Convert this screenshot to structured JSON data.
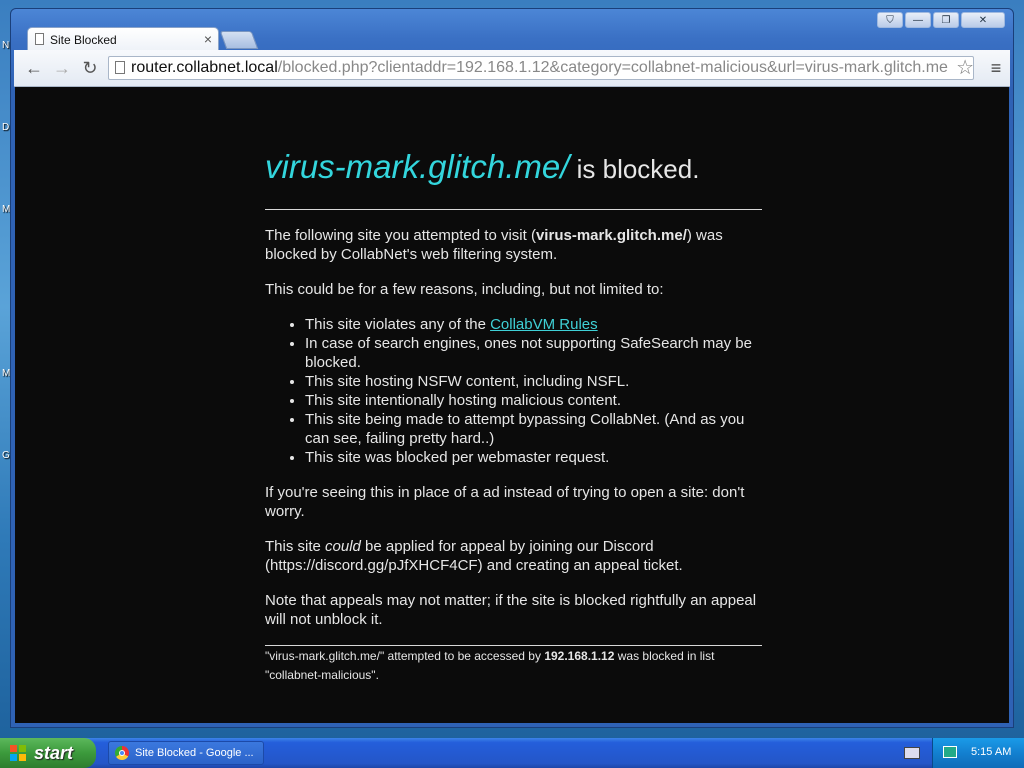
{
  "desktop": {
    "edge_letters": [
      "N",
      "D",
      "M",
      "M",
      "G"
    ]
  },
  "window": {
    "tab_title": "Site Blocked",
    "tab_close": "×",
    "controls": {
      "user": "⛉",
      "minimize": "—",
      "maximize": "❐",
      "close": "✕"
    }
  },
  "toolbar": {
    "back": "←",
    "forward": "→",
    "reload": "↻",
    "url_host": "router.collabnet.local",
    "url_path": "/blocked.php?clientaddr=192.168.1.12&category=collabnet-malicious&url=virus-mark.glitch.me",
    "star": "☆",
    "menu": "≡"
  },
  "page": {
    "heading_site": "virus-mark.glitch.me/",
    "heading_suffix": " is blocked.",
    "intro_pre": "The following site you attempted to visit (",
    "intro_site": "virus-mark.glitch.me/",
    "intro_post": ") was blocked by CollabNet's web filtering system.",
    "reasons_intro": "This could be for a few reasons, including, but not limited to:",
    "reason_1_pre": "This site violates any of the ",
    "reason_1_link": "CollabVM Rules",
    "reasons": [
      "In case of search engines, ones not supporting SafeSearch may be blocked.",
      "This site hosting NSFW content, including NSFL.",
      "This site intentionally hosting malicious content.",
      "This site being made to attempt bypassing CollabNet. (And as you can see, failing pretty hard..)",
      "This site was blocked per webmaster request."
    ],
    "ad_note": "If you're seeing this in place of a ad instead of trying to open a site: don't worry.",
    "appeal_pre": "This site ",
    "appeal_em": "could",
    "appeal_post": " be applied for appeal by joining our Discord (https://discord.gg/pJfXHCF4CF) and creating an appeal ticket.",
    "appeal_note": "Note that appeals may not matter; if the site is blocked rightfully an appeal will not unblock it.",
    "footer_pre": "\"virus-mark.glitch.me/\" attempted to be accessed by ",
    "footer_ip": "192.168.1.12",
    "footer_post": " was blocked in list \"collabnet-malicious\"."
  },
  "taskbar": {
    "start_label": "start",
    "task_label": "Site Blocked - Google ...",
    "clock": "5:15 AM"
  }
}
